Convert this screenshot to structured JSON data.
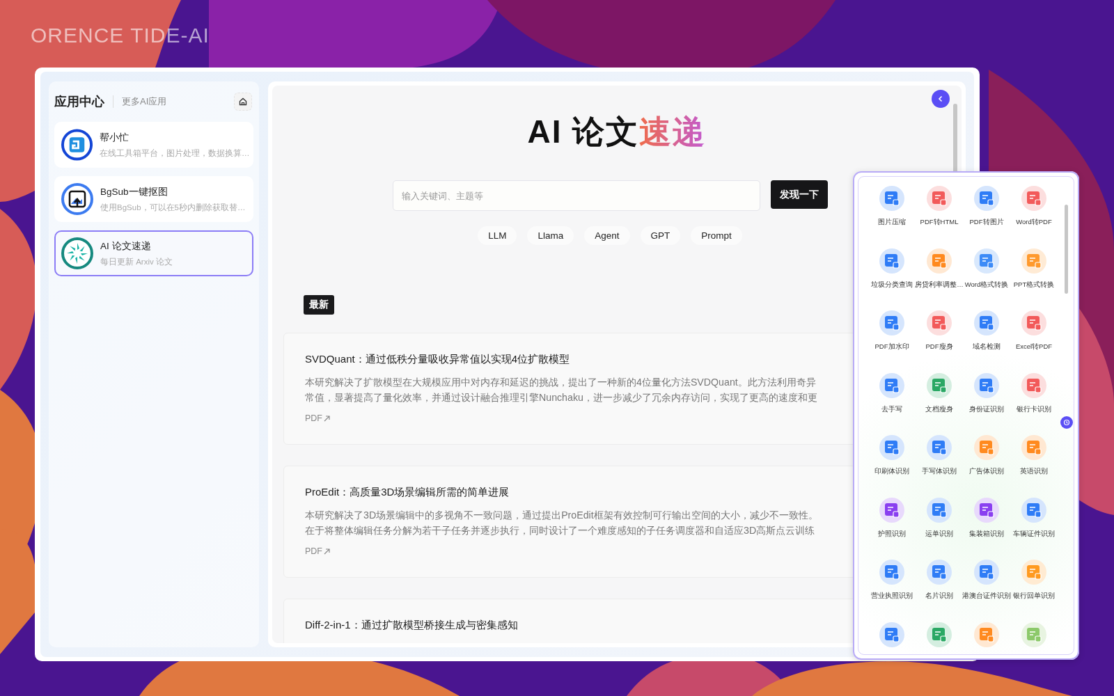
{
  "brand": "ORENCE TIDE-AI",
  "sidebar": {
    "title": "应用中心",
    "subtitle": "更多AI应用",
    "items": [
      {
        "kind": "cube",
        "title": "帮小忙",
        "description": "在线工具箱平台，图片处理，数据换算…",
        "selected": false
      },
      {
        "kind": "upload",
        "title": "BgSub一键抠图",
        "description": "使用BgSub，可以在5秒内删除获取替…",
        "selected": false
      },
      {
        "kind": "burst",
        "title": "AI 论文速递",
        "description": "每日更新 Arxiv 论文",
        "selected": true
      }
    ]
  },
  "main": {
    "title": "AI 论文",
    "title_accent": "速递",
    "search": {
      "placeholder": "输入关键词、主题等"
    },
    "search_button": "发现一下",
    "tags": [
      "LLM",
      "Llama",
      "Agent",
      "GPT",
      "Prompt"
    ],
    "section_label": "最新",
    "papers": [
      {
        "title": "SVDQuant：通过低秩分量吸收异常值以实现4位扩散模型",
        "lines": [
          "本研究解决了扩散模型在大规模应用中对内存和延迟的挑战，提出了一种新的4位量化方法SVDQuant。此方法利用奇异",
          "常值，显著提高了量化效率，并通过设计融合推理引擎Nunchaku，进一步减少了冗余内存访问，实现了更高的速度和更"
        ],
        "link": "PDF"
      },
      {
        "title": "ProEdit：高质量3D场景编辑所需的简单进展",
        "lines": [
          "本研究解决了3D场景编辑中的多视角不一致问题，通过提出ProEdit框架有效控制可行输出空间的大小，减少不一致性。",
          "在于将整体编辑任务分解为若干子任务并逐步执行，同时设计了一个难度感知的子任务调度器和自适应3D高斯点云训练"
        ],
        "link": "PDF"
      },
      {
        "title": "Diff-2-in-1：通过扩散模型桥接生成与密集感知"
      }
    ]
  },
  "tools": [
    {
      "label": "图片压缩",
      "color": "#2f7cf6"
    },
    {
      "label": "PDF转HTML",
      "color": "#f25a5a"
    },
    {
      "label": "PDF转图片",
      "color": "#2f7cf6"
    },
    {
      "label": "Word转PDF",
      "color": "#f25a5a"
    },
    {
      "label": "垃圾分类查询",
      "color": "#2f7cf6"
    },
    {
      "label": "房贷利率调整…",
      "color": "#ff8a1f"
    },
    {
      "label": "Word格式转换",
      "color": "#3d8bf7"
    },
    {
      "label": "PPT格式转换",
      "color": "#ff9a2e"
    },
    {
      "label": "PDF加水印",
      "color": "#2f7cf6"
    },
    {
      "label": "PDF瘦身",
      "color": "#f25a5a"
    },
    {
      "label": "域名检测",
      "color": "#2f7cf6"
    },
    {
      "label": "Excel转PDF",
      "color": "#f25a5a"
    },
    {
      "label": "去手写",
      "color": "#2f7cf6"
    },
    {
      "label": "文档瘦身",
      "color": "#2aa864"
    },
    {
      "label": "身份证识别",
      "color": "#2f7cf6"
    },
    {
      "label": "银行卡识别",
      "color": "#f25a5a"
    },
    {
      "label": "印刷体识别",
      "color": "#2f7cf6"
    },
    {
      "label": "手写体识别",
      "color": "#2f7cf6"
    },
    {
      "label": "广告体识别",
      "color": "#ff8a1f"
    },
    {
      "label": "英语识别",
      "color": "#ff8a1f"
    },
    {
      "label": "护照识别",
      "color": "#8a3ff0"
    },
    {
      "label": "运单识别",
      "color": "#2f7cf6"
    },
    {
      "label": "集装箱识别",
      "color": "#8a3ff0"
    },
    {
      "label": "车辆证件识别",
      "color": "#2f7cf6"
    },
    {
      "label": "营业执照识别",
      "color": "#2f7cf6"
    },
    {
      "label": "名片识别",
      "color": "#2f7cf6"
    },
    {
      "label": "港澳台证件识别",
      "color": "#2f7cf6"
    },
    {
      "label": "银行回单识别",
      "color": "#ff9a1f"
    },
    {
      "color": "#2f7cf6"
    },
    {
      "color": "#2aa864"
    },
    {
      "color": "#ff8a1f"
    },
    {
      "color": "#8cc96a"
    }
  ]
}
